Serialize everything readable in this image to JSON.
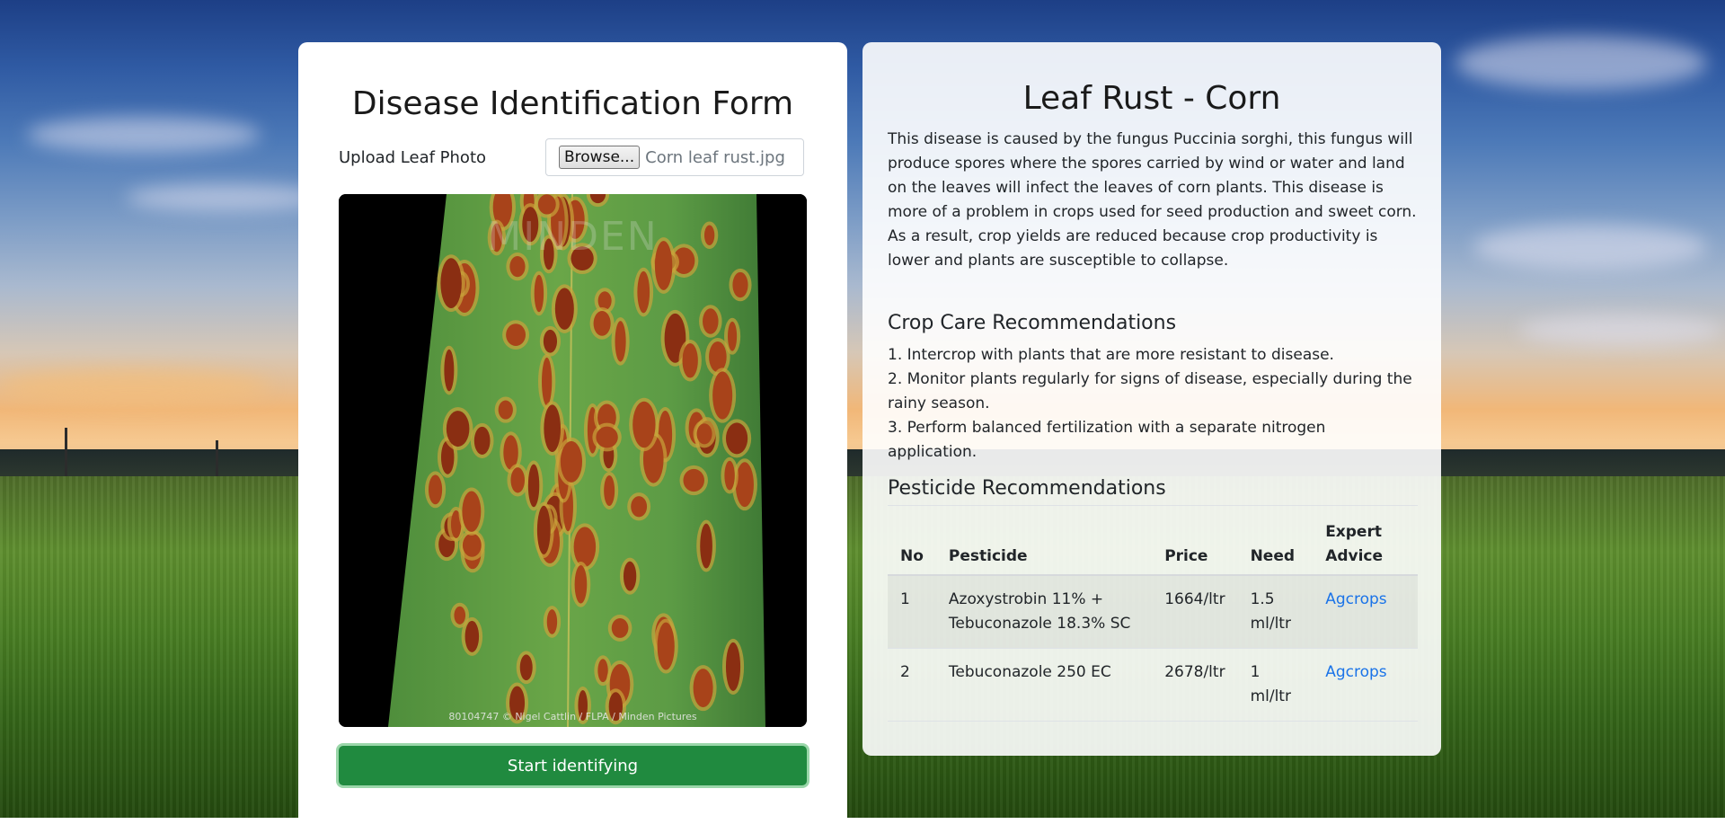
{
  "form": {
    "title": "Disease Identification Form",
    "upload_label": "Upload Leaf Photo",
    "browse_label": "Browse...",
    "file_name": "Corn leaf rust.jpg",
    "photo_watermark": "MINDEN",
    "photo_credit": "80104747 © Nigel Cattlin / FLPA / Minden Pictures",
    "submit_label": "Start identifying",
    "submit_color": "#208a3f"
  },
  "result": {
    "title": "Leaf Rust - Corn",
    "description": "This disease is caused by the fungus Puccinia sorghi, this fungus will produce spores where the spores carried by wind or water and land on the leaves will infect the leaves of corn plants. This disease is more of a problem in crops used for seed production and sweet corn. As a result, crop yields are reduced because crop productivity is lower and plants are susceptible to collapse.",
    "care_heading": "Crop Care Recommendations",
    "care_items": [
      "1. Intercrop with plants that are more resistant to disease.",
      "2. Monitor plants regularly for signs of disease, especially during the rainy season.",
      "3. Perform balanced fertilization with a separate nitrogen application."
    ],
    "pesticide_heading": "Pesticide Recommendations",
    "table": {
      "headers": [
        "No",
        "Pesticide",
        "Price",
        "Need",
        "Expert Advice"
      ],
      "rows": [
        {
          "no": "1",
          "pesticide": "Azoxystrobin 11% + Tebuconazole 18.3% SC",
          "price": "1664/ltr",
          "need": "1.5 ml/ltr",
          "advice": "Agcrops"
        },
        {
          "no": "2",
          "pesticide": "Tebuconazole 250 EC",
          "price": "2678/ltr",
          "need": "1 ml/ltr",
          "advice": "Agcrops"
        }
      ]
    },
    "link_color": "#1a73e8"
  }
}
